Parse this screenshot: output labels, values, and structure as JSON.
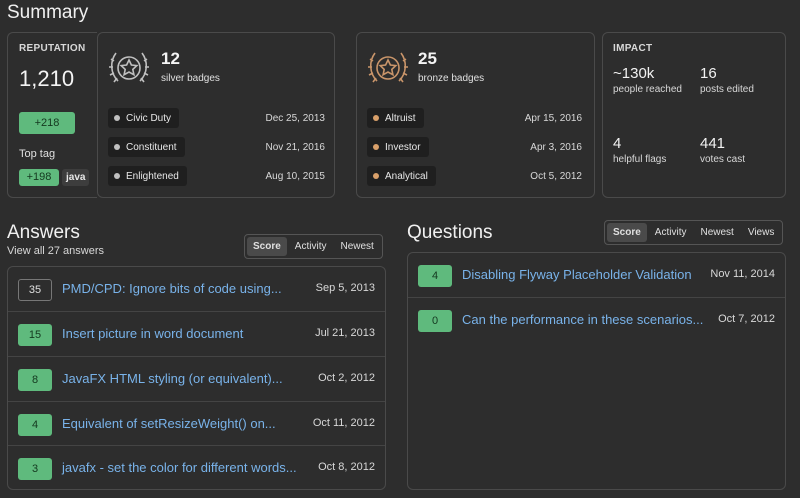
{
  "summary": {
    "title": "Summary",
    "reputation_label": "REPUTATION",
    "reputation_value": "1,210",
    "reputation_change": "+218",
    "top_tag_label": "Top tag",
    "top_tag_score": "+198",
    "top_tag_name": "java"
  },
  "silver": {
    "count": "12",
    "label": "silver badges",
    "color": "#c0c0c0",
    "items": [
      {
        "name": "Civic Duty",
        "date": "Dec 25, 2013"
      },
      {
        "name": "Constituent",
        "date": "Nov 21, 2016"
      },
      {
        "name": "Enlightened",
        "date": "Aug 10, 2015"
      }
    ]
  },
  "bronze": {
    "count": "25",
    "label": "bronze badges",
    "color": "#c9956a",
    "items": [
      {
        "name": "Altruist",
        "date": "Apr 15, 2016"
      },
      {
        "name": "Investor",
        "date": "Apr 3, 2016"
      },
      {
        "name": "Analytical",
        "date": "Oct 5, 2012"
      }
    ]
  },
  "impact": {
    "label": "IMPACT",
    "stats": [
      {
        "value": "~130k",
        "label": "people reached"
      },
      {
        "value": "16",
        "label": "posts edited"
      },
      {
        "value": "4",
        "label": "helpful flags"
      },
      {
        "value": "441",
        "label": "votes cast"
      }
    ]
  },
  "answers": {
    "title": "Answers",
    "view_all": "View all 27 answers",
    "tabs": [
      "Score",
      "Activity",
      "Newest"
    ],
    "rows": [
      {
        "score": "35",
        "title": "PMD/CPD: Ignore bits of code using...",
        "date": "Sep 5, 2013",
        "accepted": false
      },
      {
        "score": "15",
        "title": "Insert picture in word document",
        "date": "Jul 21, 2013",
        "accepted": true
      },
      {
        "score": "8",
        "title": "JavaFX HTML styling (or equivalent)...",
        "date": "Oct 2, 2012",
        "accepted": true
      },
      {
        "score": "4",
        "title": "Equivalent of setResizeWeight() on...",
        "date": "Oct 11, 2012",
        "accepted": true
      },
      {
        "score": "3",
        "title": "javafx - set the color for different words...",
        "date": "Oct 8, 2012",
        "accepted": true
      }
    ]
  },
  "questions": {
    "title": "Questions",
    "tabs": [
      "Score",
      "Activity",
      "Newest",
      "Views"
    ],
    "rows": [
      {
        "score": "4",
        "title": "Disabling Flyway Placeholder Validation",
        "date": "Nov 11, 2014",
        "accepted": true
      },
      {
        "score": "0",
        "title": "Can the performance in these scenarios...",
        "date": "Oct 7, 2012",
        "accepted": true
      }
    ]
  },
  "colors": {
    "accent_green": "#5fba7d",
    "link": "#79b3ea",
    "silver": "#c0c0c0",
    "bronze": "#c9956a",
    "bronze_dot": "#d9a06a"
  }
}
